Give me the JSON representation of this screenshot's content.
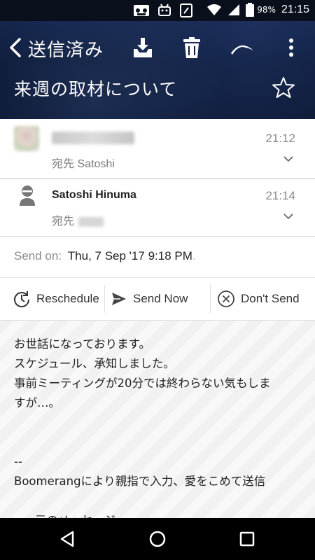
{
  "status_bar": {
    "battery": "98%",
    "time": "21:15"
  },
  "toolbar": {
    "folder_title": "送信済み",
    "icons": [
      "back-icon",
      "archive-icon",
      "trash-icon",
      "boomerang-icon",
      "more-icon"
    ]
  },
  "subject": "来週の取材について",
  "messages": [
    {
      "to": "宛先 Satoshi",
      "time": "21:12"
    },
    {
      "sender": "Satoshi Hinuma",
      "to": "宛先",
      "time": "21:14"
    }
  ],
  "send_on": {
    "label": "Send on:",
    "value": "Thu, 7 Sep '17 9:18 PM",
    "suffix": "."
  },
  "actions": {
    "reschedule": "Reschedule",
    "send_now": "Send Now",
    "dont_send": "Don't Send"
  },
  "body_text": "お世話になっております。\nスケジュール、承知しました。\n事前ミーティングが20分では終わらない気もしま\nすが…。\n\n\n--\nBoomerangにより親指で入力、愛をこめて送信\n\n-----元のメッセージ-----\n来週の取材について"
}
